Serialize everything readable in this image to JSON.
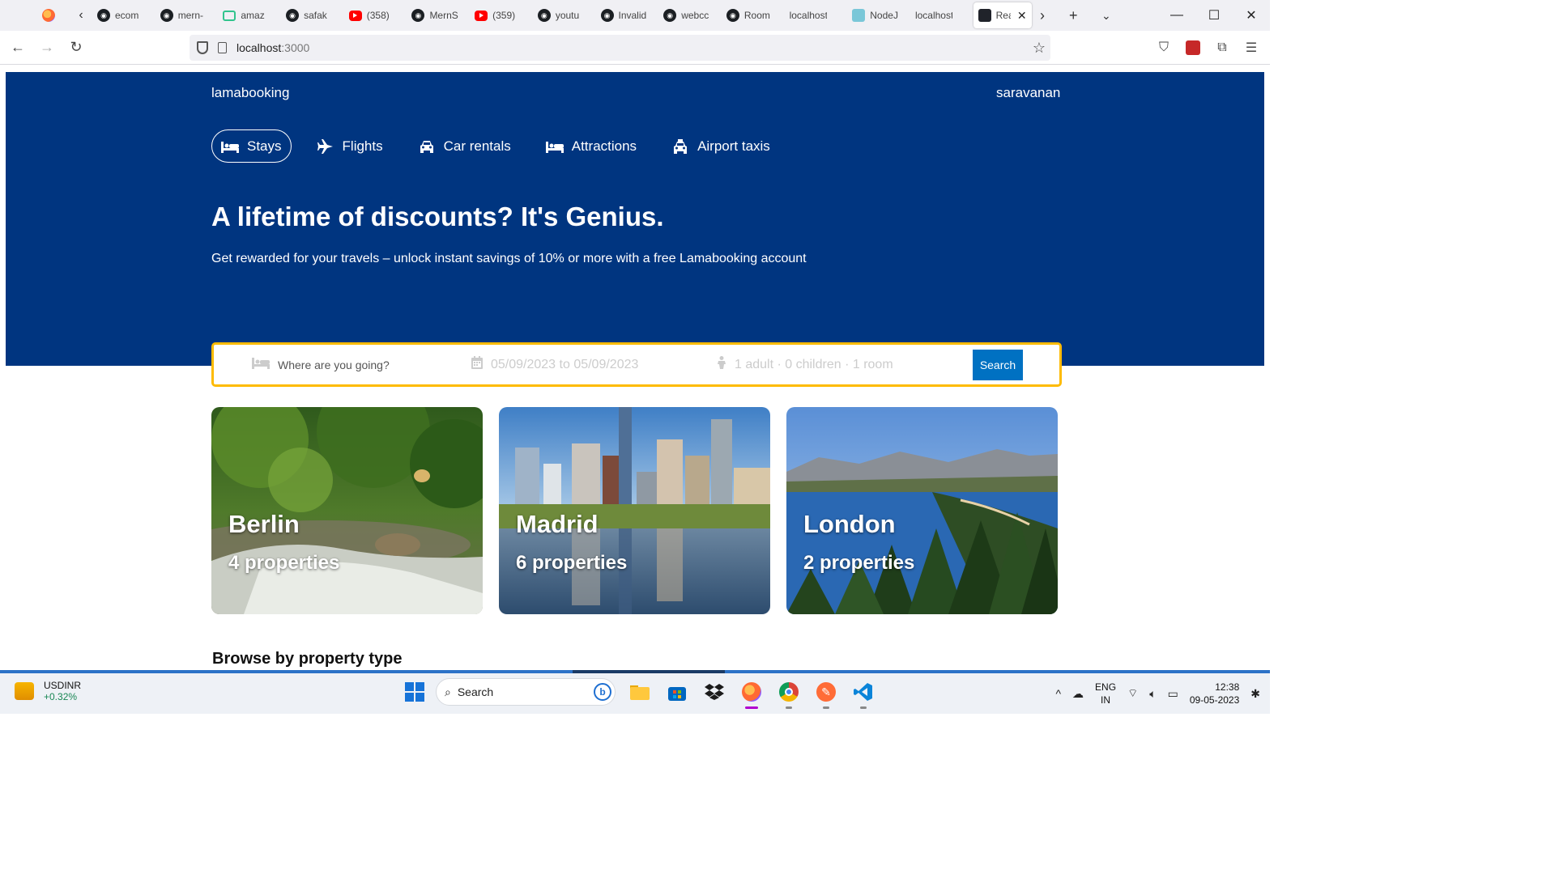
{
  "browser": {
    "tabs": [
      {
        "icon": "github-icon",
        "label": "ecom"
      },
      {
        "icon": "github-icon",
        "label": "mern-"
      },
      {
        "icon": "square-icon",
        "label": "amaz"
      },
      {
        "icon": "github-icon",
        "label": "safak"
      },
      {
        "icon": "youtube-icon",
        "label": "(358)"
      },
      {
        "icon": "github-icon",
        "label": "MernS"
      },
      {
        "icon": "youtube-icon",
        "label": "(359)"
      },
      {
        "icon": "github-icon",
        "label": "youtu"
      },
      {
        "icon": "github-icon",
        "label": "Invalid"
      },
      {
        "icon": "github-icon",
        "label": "webcc"
      },
      {
        "icon": "github-icon",
        "label": "Room"
      },
      {
        "icon": "none",
        "label": "localhost:"
      },
      {
        "icon": "node-icon",
        "label": "NodeJ"
      },
      {
        "icon": "none",
        "label": "localhost:"
      },
      {
        "icon": "react-icon",
        "label": "Rea"
      }
    ],
    "url_host": "localhost",
    "url_port": ":3000"
  },
  "site": {
    "logo": "lamabooking",
    "user": "saravanan",
    "nav": [
      {
        "label": "Stays",
        "icon": "bed-icon",
        "active": true
      },
      {
        "label": "Flights",
        "icon": "plane-icon",
        "active": false
      },
      {
        "label": "Car rentals",
        "icon": "car-icon",
        "active": false
      },
      {
        "label": "Attractions",
        "icon": "bed-icon",
        "active": false
      },
      {
        "label": "Airport taxis",
        "icon": "taxi-icon",
        "active": false
      }
    ],
    "hero_title": "A lifetime of discounts? It's Genius.",
    "hero_desc": "Get rewarded for your travels – unlock instant savings of 10% or more with a free Lamabooking account",
    "search": {
      "destination_placeholder": "Where are you going?",
      "dates": "05/09/2023 to 05/09/2023",
      "options": "1 adult · 0 children · 1 room",
      "button": "Search"
    },
    "featured": [
      {
        "city": "Berlin",
        "count": "4 properties"
      },
      {
        "city": "Madrid",
        "count": "6 properties"
      },
      {
        "city": "London",
        "count": "2 properties"
      }
    ],
    "browse_title": "Browse by property type"
  },
  "taskbar": {
    "ticker_name": "USDINR",
    "ticker_change": "+0.32%",
    "search_label": "Search",
    "lang_1": "ENG",
    "lang_2": "IN",
    "time": "12:38",
    "date": "09-05-2023"
  },
  "colors": {
    "brand": "#003580",
    "search_border": "#febb02",
    "button": "#0071c2"
  }
}
